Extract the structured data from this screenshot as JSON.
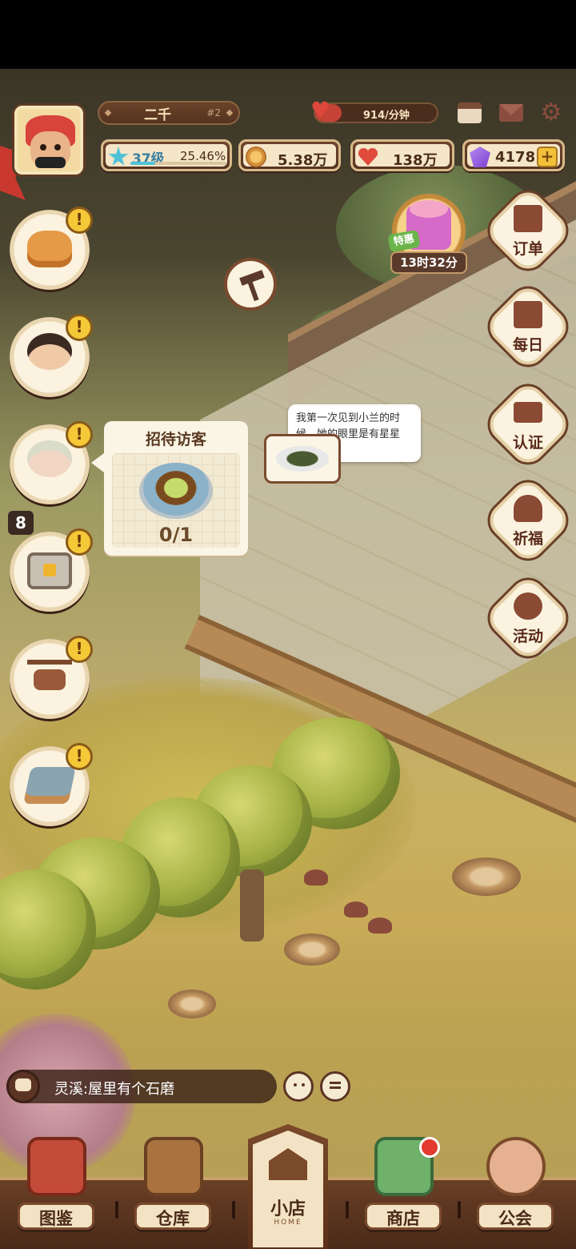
{
  "player": {
    "name": "二千",
    "server": "#2",
    "heart_rate": "914/分钟",
    "heart_rate_fill": 0.22
  },
  "stats": {
    "level": "37级",
    "level_progress": "25.46%",
    "level_progress_value": 0.2546,
    "coins": "5.38万",
    "hearts": "138万",
    "gems": "4178",
    "add": "+"
  },
  "top_icons": [
    "calendar-icon",
    "mail-icon",
    "gear-icon"
  ],
  "left_menu": {
    "alert": "!",
    "badge": "8"
  },
  "guest_card": {
    "title": "招待访客",
    "count": "0/1"
  },
  "speech": {
    "text": "我第一次见到小兰的时候，她的眼里是有星星的。"
  },
  "gift": {
    "tag": "特惠",
    "timer": "13时32分"
  },
  "right_menu": [
    {
      "label": "订单",
      "icon": "order-icon"
    },
    {
      "label": "每日",
      "icon": "daily-icon"
    },
    {
      "label": "认证",
      "icon": "id-card-icon"
    },
    {
      "label": "祈福",
      "icon": "pray-icon"
    },
    {
      "label": "活动",
      "icon": "event-icon"
    }
  ],
  "chat": {
    "message": "灵溪:屋里有个石磨"
  },
  "bottom_nav": {
    "atlas": "图鉴",
    "storage": "仓库",
    "home": "小店",
    "home_sub": "HOME",
    "shop": "商店",
    "guild": "公会"
  },
  "colors": {
    "accent_brown": "#5a3a22",
    "cream": "#fbf5e6",
    "alert_yellow": "#f5c838",
    "notify_red": "#e23a2e"
  }
}
